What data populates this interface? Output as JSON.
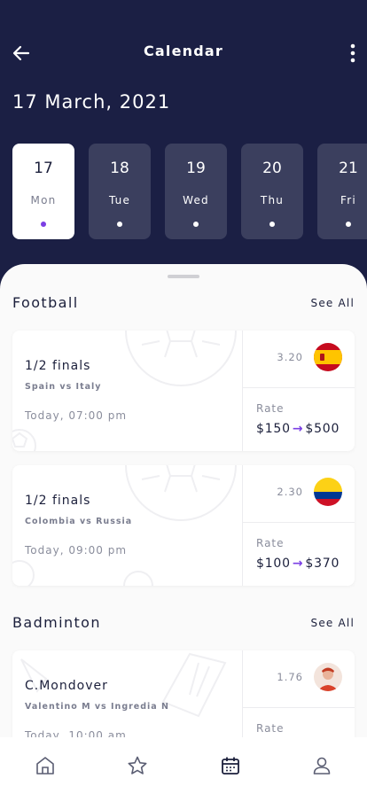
{
  "header": {
    "title": "Calendar",
    "date": "17 March, 2021",
    "background_color": "#1b1f44"
  },
  "days": [
    {
      "num": "17",
      "weekday": "Mon",
      "selected": true
    },
    {
      "num": "18",
      "weekday": "Tue",
      "selected": false
    },
    {
      "num": "19",
      "weekday": "Wed",
      "selected": false
    },
    {
      "num": "20",
      "weekday": "Thu",
      "selected": false
    },
    {
      "num": "21",
      "weekday": "Fri",
      "selected": false
    }
  ],
  "sections": {
    "football": {
      "title": "Football",
      "see_all": "See All",
      "cards": [
        {
          "match": "1/2 finals",
          "teams": "Spain vs Italy",
          "time": "Today, 07:00 pm",
          "odds": "3.20",
          "flag": "spain-flag-icon",
          "rate_label": "Rate",
          "rate_from": "$150",
          "rate_to": "$500"
        },
        {
          "match": "1/2 finals",
          "teams": "Colombia vs Russia",
          "time": "Today, 09:00 pm",
          "odds": "2.30",
          "flag": "colombia-flag-icon",
          "rate_label": "Rate",
          "rate_from": "$100",
          "rate_to": "$370"
        }
      ]
    },
    "badminton": {
      "title": "Badminton",
      "see_all": "See All",
      "cards": [
        {
          "match": "C.Mondover",
          "teams": "Valentino M vs Ingredia N",
          "time": "Today, 10:00 am",
          "odds": "1.76",
          "flag": "player-avatar",
          "rate_label": "Rate"
        }
      ]
    }
  },
  "nav": [
    "home-icon",
    "star-icon",
    "calendar-icon",
    "profile-icon"
  ],
  "colors": {
    "accent": "#7b3fe4",
    "dark": "#1b1f3b"
  }
}
